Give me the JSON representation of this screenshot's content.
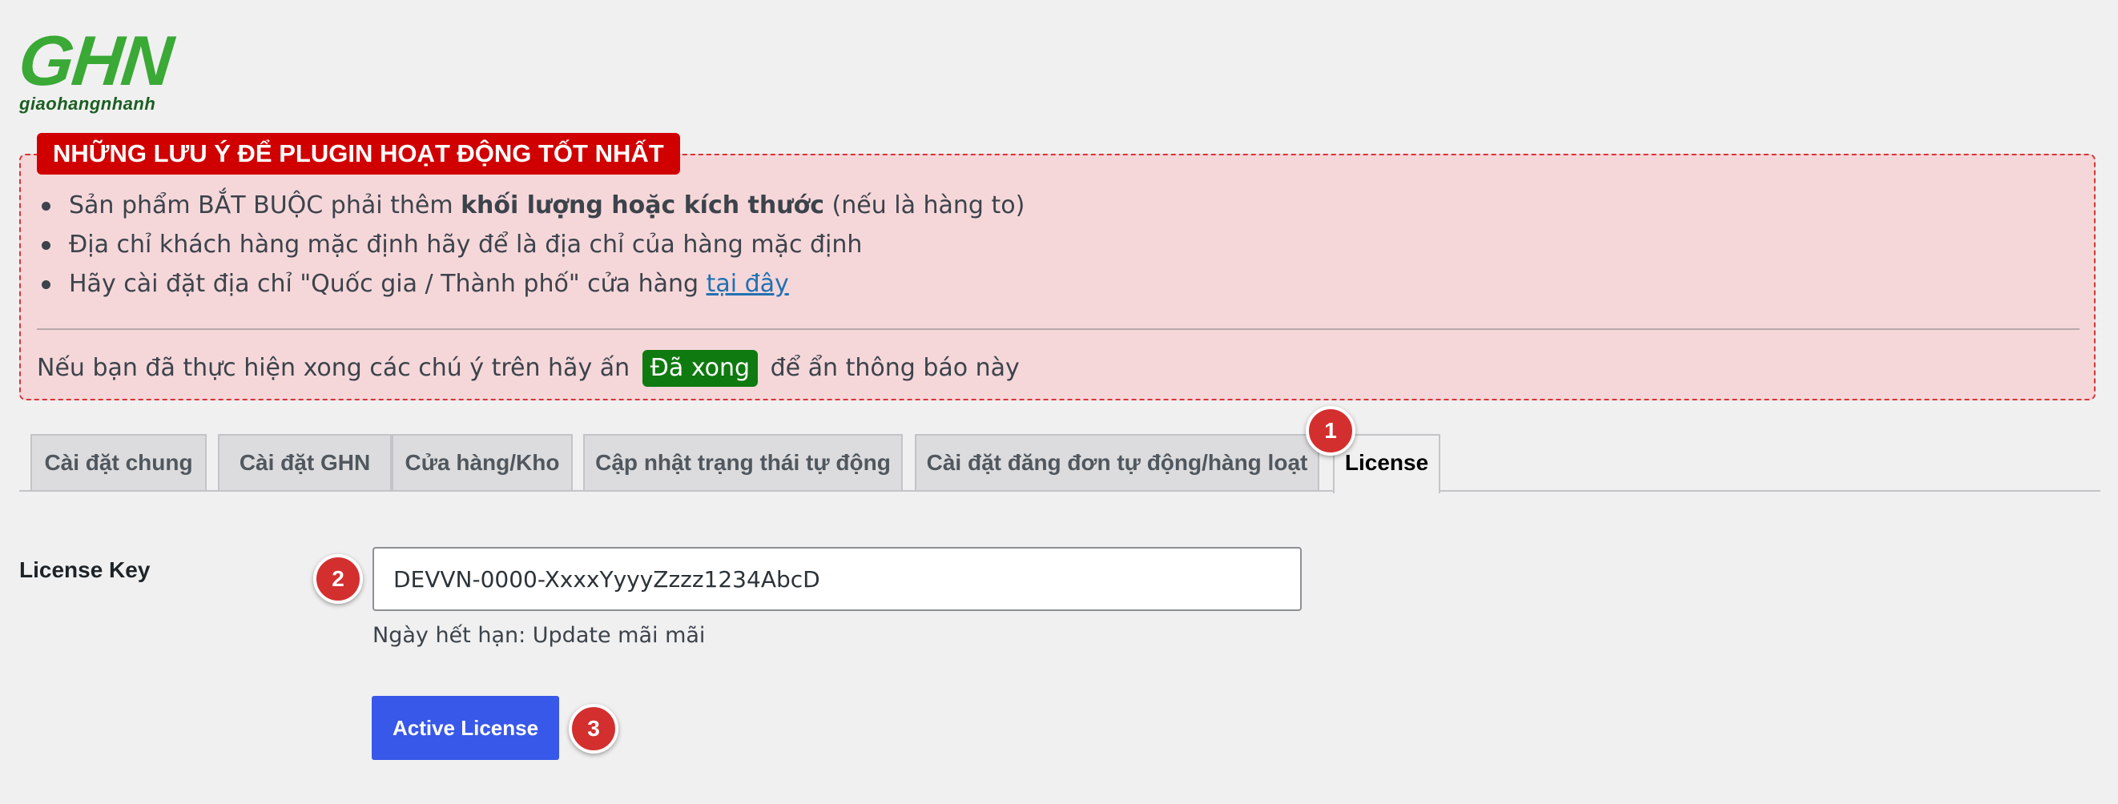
{
  "brand": {
    "logo_mark": "GHN",
    "logo_sub": "giaohangnhanh",
    "primary_color": "#3aa935"
  },
  "notice": {
    "title": "NHỮNG LƯU Ý ĐỂ PLUGIN HOẠT ĐỘNG TỐT NHẤT",
    "item1_before": "Sản phẩm BẮT BUỘC phải thêm ",
    "item1_bold": "khối lượng hoặc kích thước",
    "item1_after": " (nếu là hàng to)",
    "item2": "Địa chỉ khách hàng mặc định hãy để là địa chỉ của hàng mặc định",
    "item3_before": "Hãy cài đặt địa chỉ \"Quốc gia / Thành phố\" cửa hàng ",
    "item3_link": "tại đây",
    "bottom_before": "Nếu bạn đã thực hiện xong các chú ý trên hãy ấn ",
    "done_button": "Đã xong",
    "bottom_after": " để ẩn thông báo này",
    "title_color": "#d10000",
    "background_color": "#f5d7da"
  },
  "tabs": [
    {
      "label": "Cài đặt chung",
      "active": false
    },
    {
      "label": "Cài đặt GHN",
      "active": false
    },
    {
      "label": "Cửa hàng/Kho",
      "active": false
    },
    {
      "label": "Cập nhật trạng thái tự động",
      "active": false
    },
    {
      "label": "Cài đặt đăng đơn tự động/hàng loạt",
      "active": false
    },
    {
      "label": "License",
      "active": true
    }
  ],
  "steps": [
    "1",
    "2",
    "3"
  ],
  "form": {
    "license_label": "License Key",
    "license_value": "DEVVN-0000-XxxxYyyyZzzz1234AbcD",
    "expiry_text": "Ngày hết hạn: Update mãi mãi",
    "active_button": "Active License",
    "button_color": "#3858e9"
  }
}
